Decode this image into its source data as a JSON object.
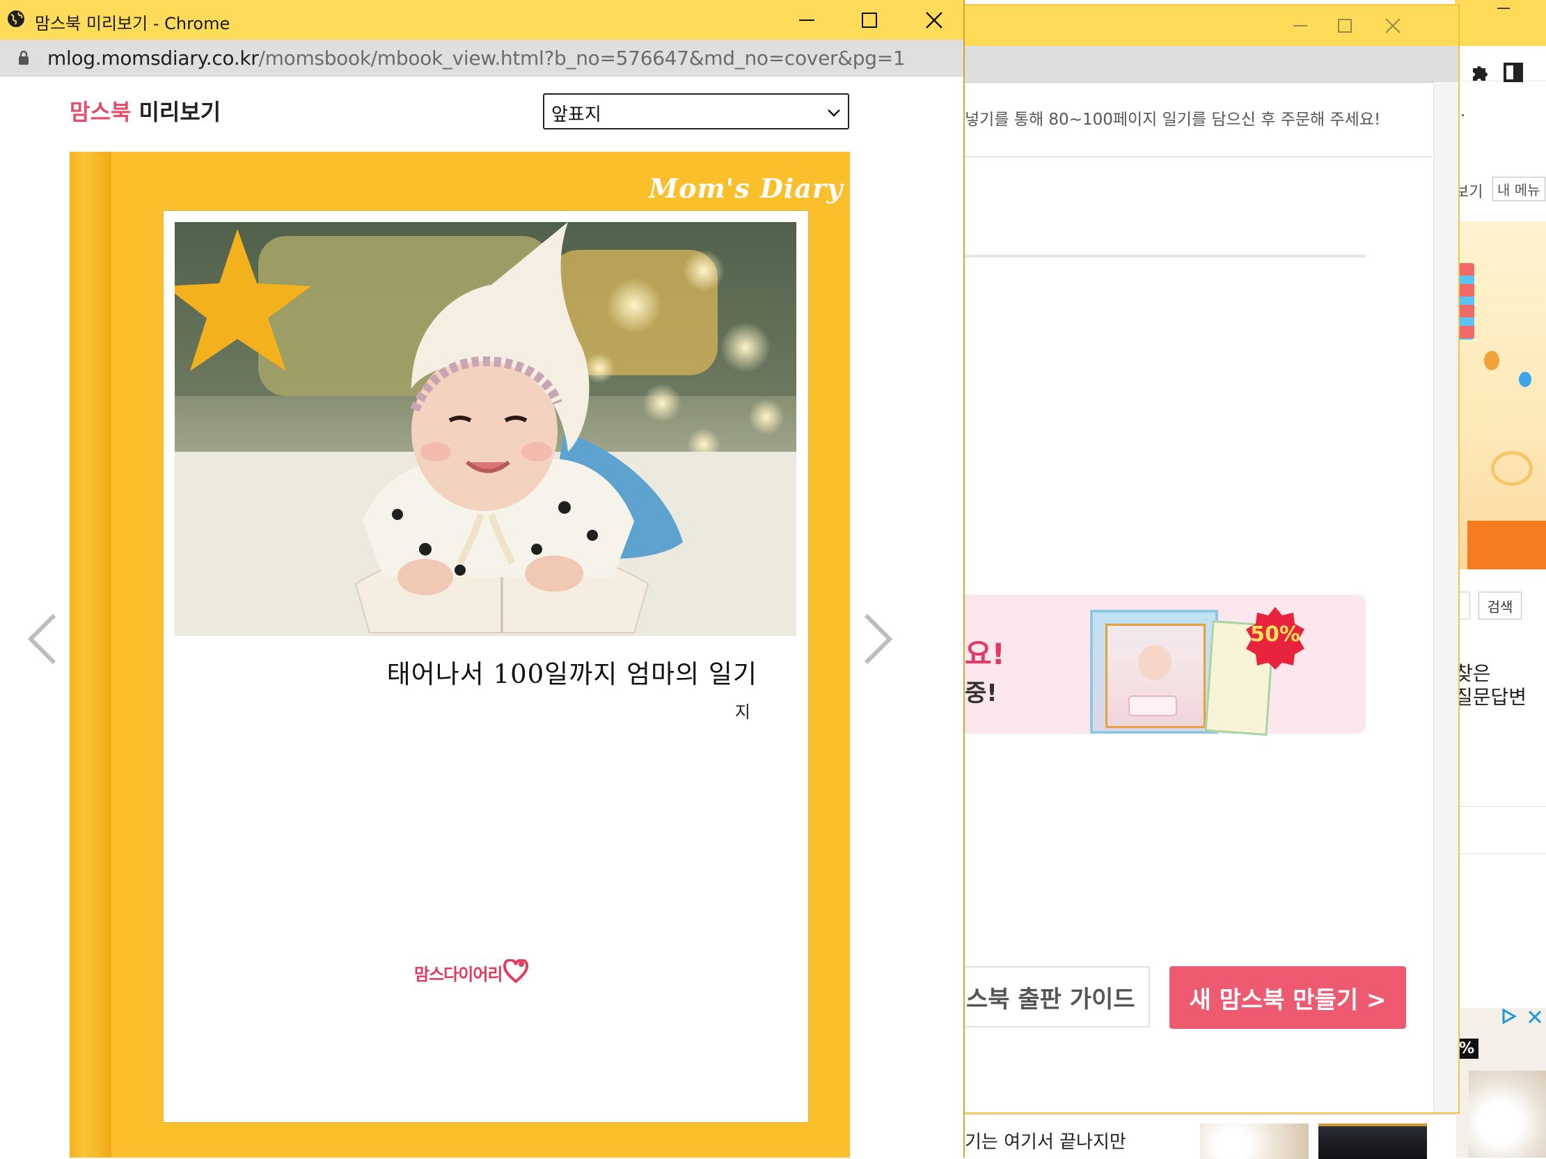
{
  "back_window_right": {
    "toolbar_icons": [
      "puzzle-icon",
      "side-panel-icon"
    ],
    "dot_text": ".",
    "tab_partial": "보기",
    "my_menu_button": "내 메뉴",
    "search_button": "검색",
    "qna_text_line1": "찾은",
    "qna_text_line2": "질문답변",
    "ad_discount": "%"
  },
  "back_window_middle": {
    "notice_text": "넣기를 통해 80~100페이지 일기를 담으신 후 주문해 주세요!",
    "banner": {
      "headline_partial": "요!",
      "subline_partial": "중!",
      "discount_badge": "50%"
    },
    "guide_button": "스북 출판 가이드",
    "new_book_button": "새 맘스북 만들기 >",
    "bottom_text": "기는 여기서 끝나지만"
  },
  "popup": {
    "window_title": "맘스북 미리보기 - Chrome",
    "url_domain": "mlog.momsdiary.co.kr",
    "url_path": "/momsbook/mbook_view.html?b_no=576647&md_no=cover&pg=1",
    "logo_part1": "맘스북",
    "logo_part2": "미리보기",
    "page_select": {
      "selected": "앞표지"
    },
    "cover": {
      "brand_script": "Mom's Diary",
      "book_title": "태어나서 100일까지 엄마의 일기",
      "author": "지",
      "publisher_logo": "맘스다이어리"
    },
    "colors": {
      "titlebar": "#fedc5a",
      "cover_yellow": "#fbbf2c",
      "brand_pink": "#e84c6c"
    }
  }
}
